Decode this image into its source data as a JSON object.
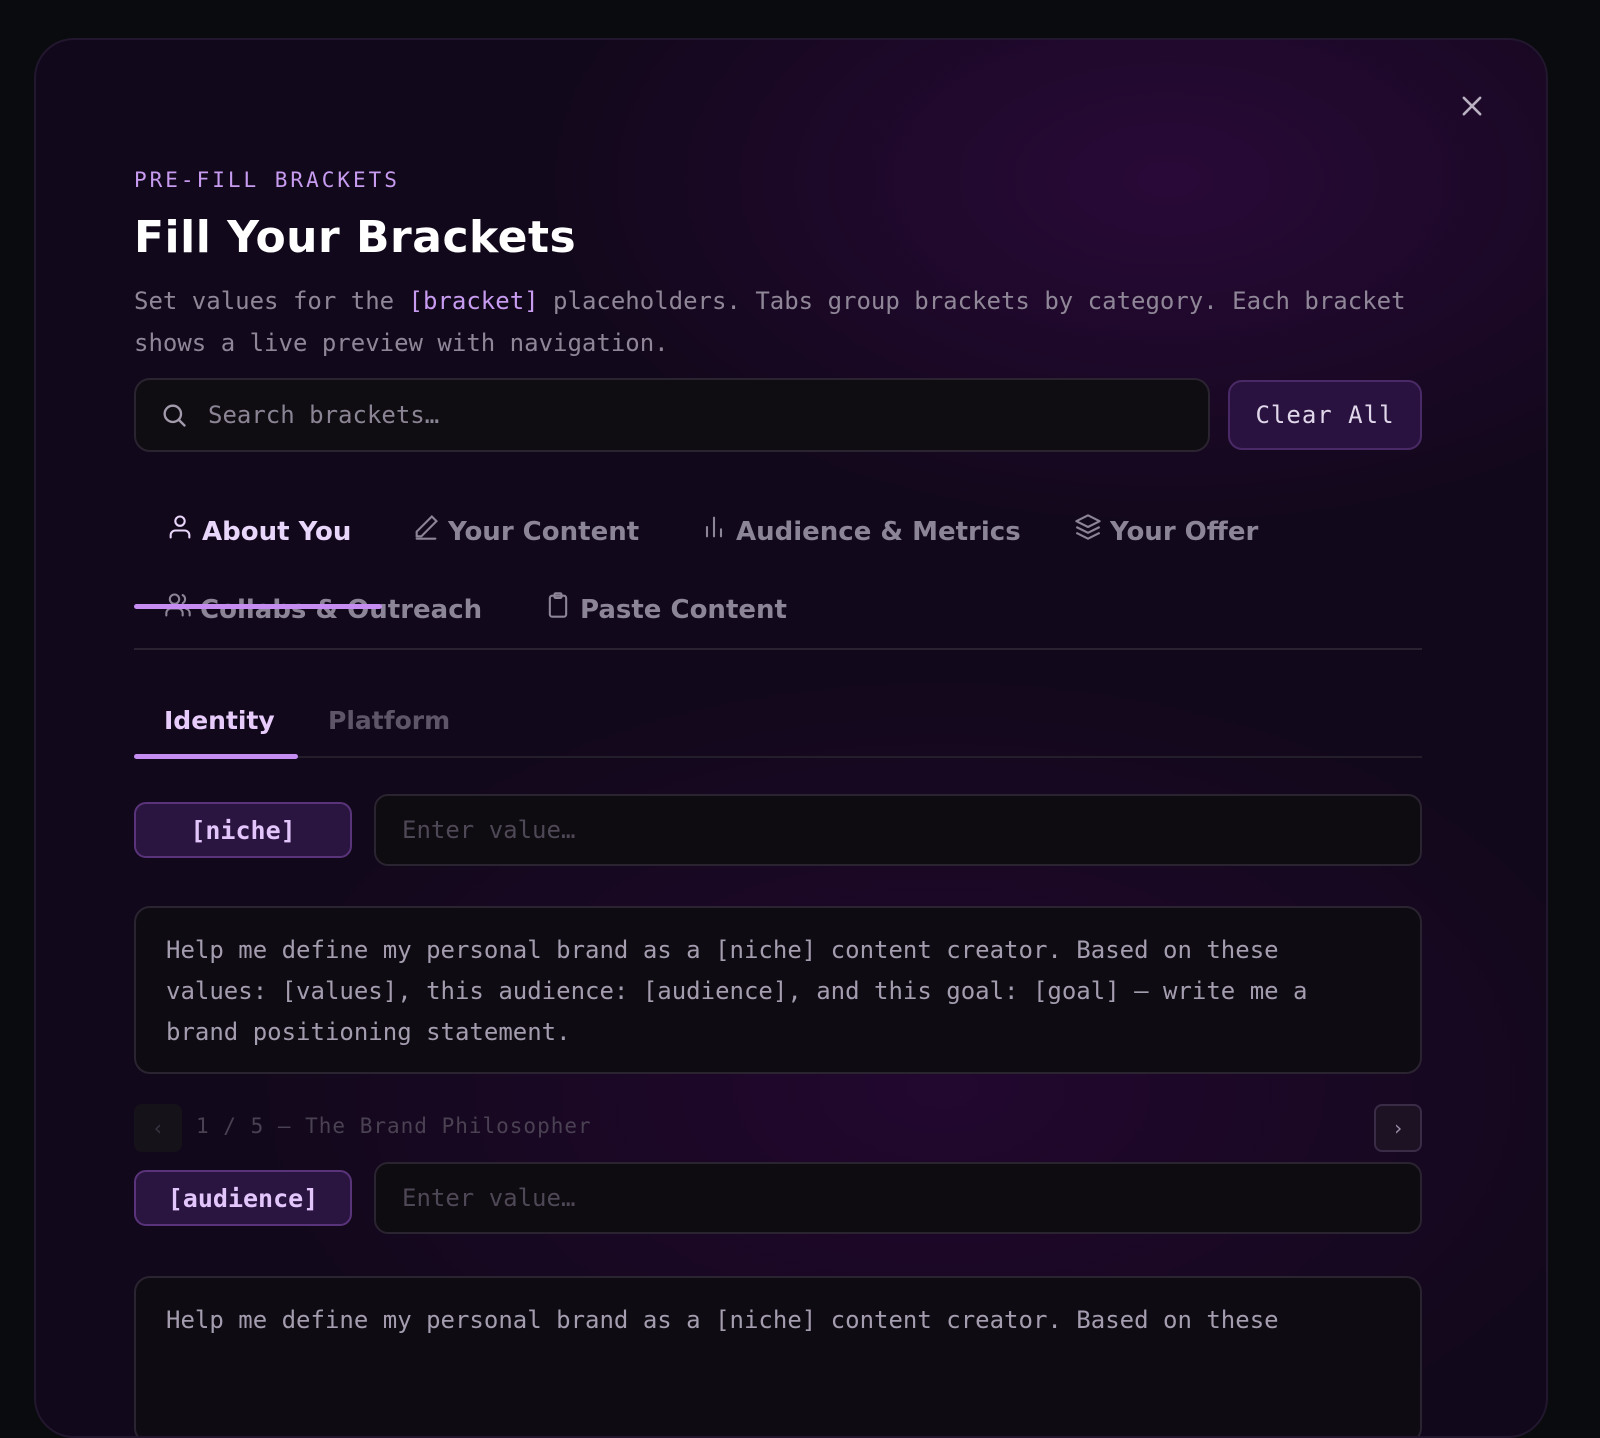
{
  "modal": {
    "close_icon": "close-icon",
    "kicker": "PRE-FILL BRACKETS",
    "title": "Fill Your Brackets",
    "description": {
      "before": "Set values for the ",
      "highlight": "[bracket]",
      "after": " placeholders. Tabs group brackets by category. Each bracket shows a live preview with navigation."
    }
  },
  "search": {
    "icon": "search-icon",
    "placeholder": "Search brackets…",
    "value": ""
  },
  "clear_all_label": "Clear All",
  "tabs": [
    {
      "label": "About You",
      "icon": "user-icon",
      "active": true
    },
    {
      "label": "Your Content",
      "icon": "pencil-icon",
      "active": false
    },
    {
      "label": "Audience & Metrics",
      "icon": "bar-chart-icon",
      "active": false
    },
    {
      "label": "Your Offer",
      "icon": "layers-icon",
      "active": false
    },
    {
      "label": "Collabs & Outreach",
      "icon": "users-icon",
      "active": false
    },
    {
      "label": "Paste Content",
      "icon": "clipboard-icon",
      "active": false
    }
  ],
  "subtabs": [
    {
      "label": "Identity",
      "active": true
    },
    {
      "label": "Platform",
      "active": false
    }
  ],
  "brackets": [
    {
      "tag": "[niche]",
      "placeholder": "Enter value…",
      "value": "",
      "preview": "Help me define my personal brand as a [niche] content creator. Based on these values: [values], this audience: [audience], and this goal: [goal] — write me a brand positioning statement.",
      "nav": {
        "prev": "‹",
        "label": "1 / 5 — The Brand Philosopher",
        "next": "›"
      }
    },
    {
      "tag": "[audience]",
      "placeholder": "Enter value…",
      "value": "",
      "preview": "Help me define my personal brand as a [niche] content creator. Based on these"
    }
  ],
  "colors": {
    "accent": "#c58cf2",
    "background": "#12081b",
    "tag_bg": "#2a1440"
  }
}
